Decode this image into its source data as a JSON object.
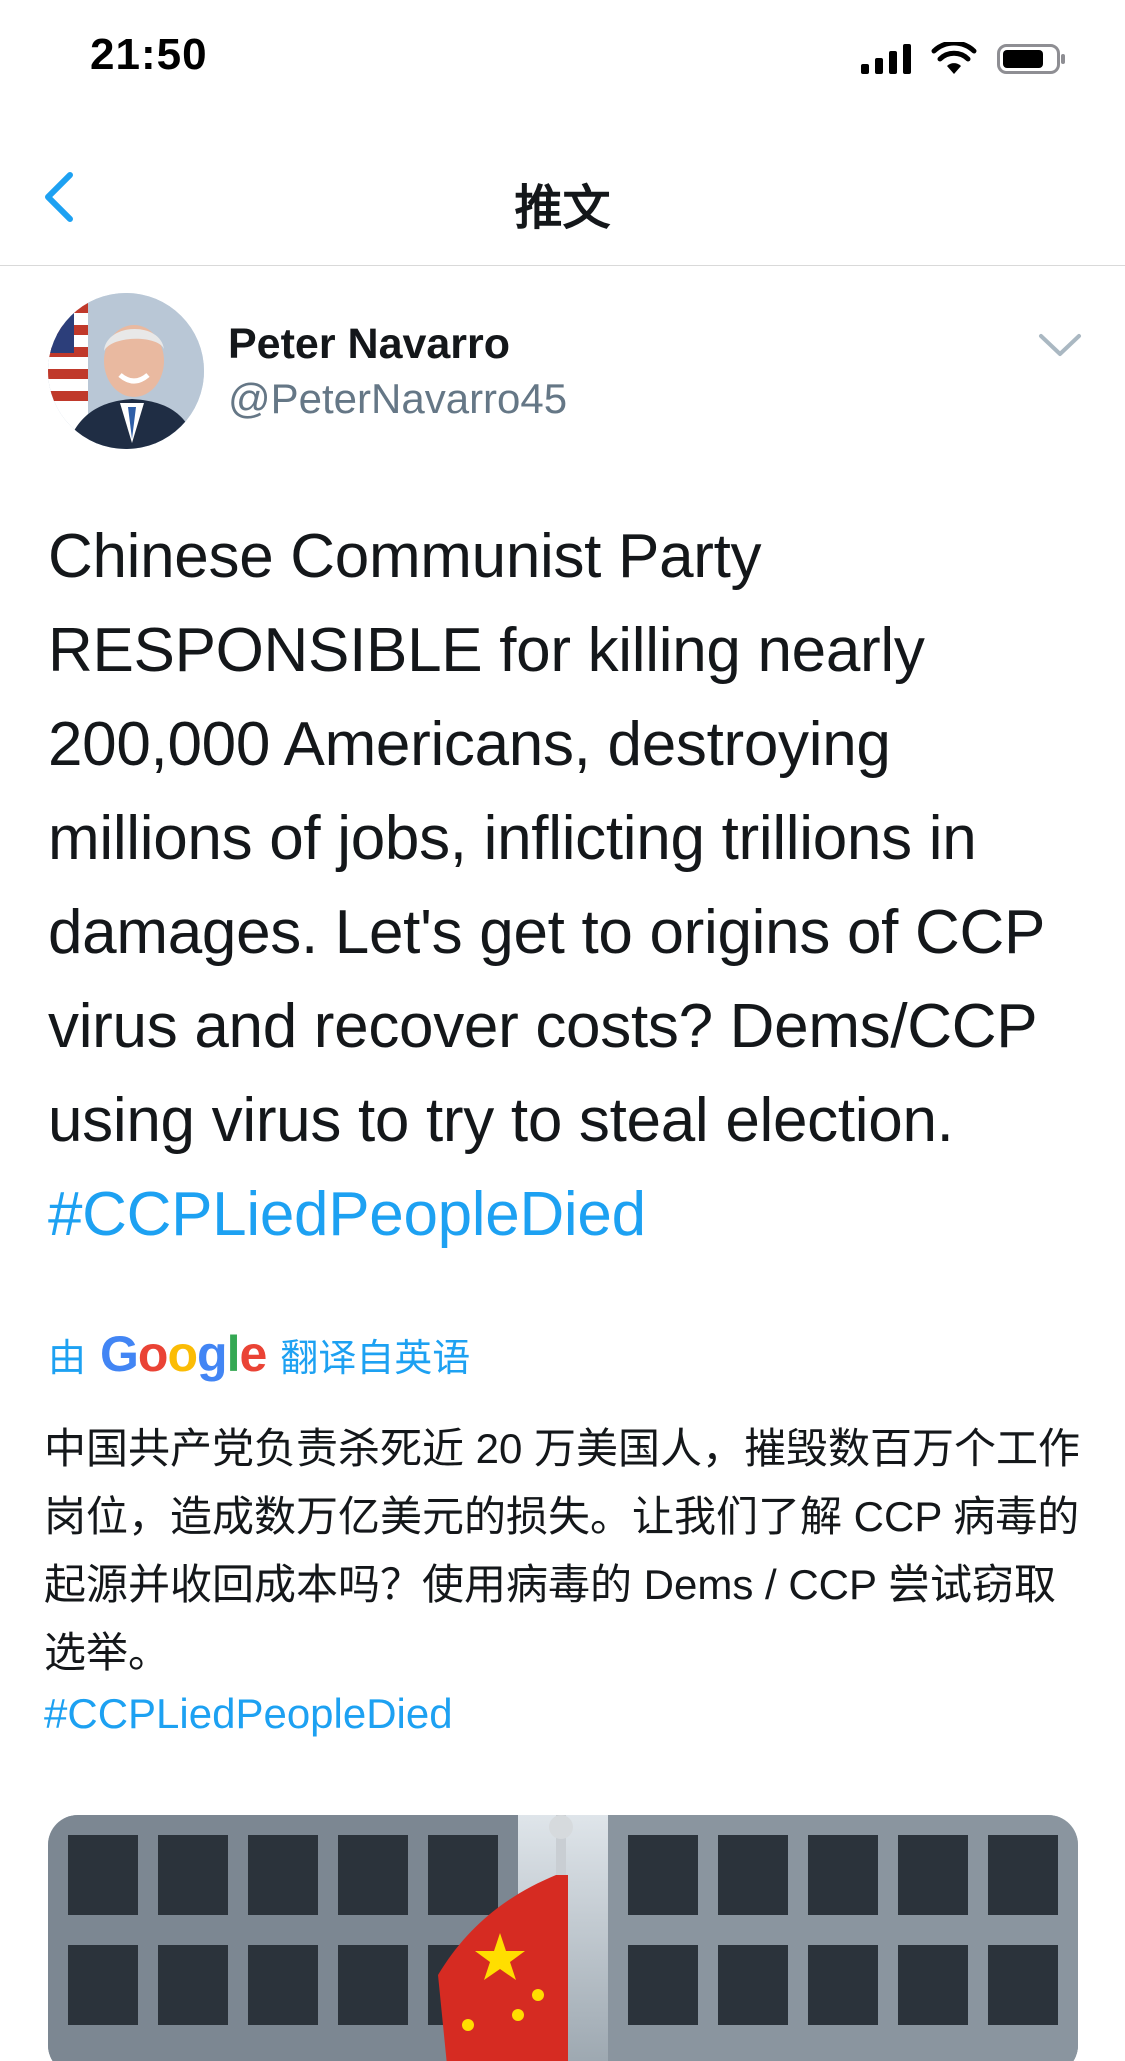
{
  "status_bar": {
    "time": "21:50"
  },
  "nav": {
    "title": "推文"
  },
  "tweet": {
    "author_name": "Peter Navarro",
    "handle": "@PeterNavarro45",
    "text": "Chinese Communist Party RESPONSIBLE for killing nearly 200,000 Americans, destroying millions of jobs, inflicting trillions in damages. Let's get to origins of CCP virus and recover costs? Dems/CCP using virus to try to steal election.",
    "hashtag": "#CCPLiedPeopleDied"
  },
  "translation": {
    "prefix": "由",
    "google_letters": [
      "G",
      "o",
      "o",
      "g",
      "l",
      "e"
    ],
    "suffix": "翻译自英语",
    "text": "中国共产党负责杀死近 20 万美国人，摧毁数百万个工作岗位，造成数万亿美元的损失。让我们了解 CCP 病毒的起源并收回成本吗？使用病毒的 Dems / CCP 尝试窃取选举。",
    "hashtag": "#CCPLiedPeopleDied"
  },
  "icons": {
    "back": "chevron-left-icon",
    "more": "chevron-down-icon"
  },
  "colors": {
    "accent": "#1da1f2",
    "text": "#14171a",
    "secondary": "#657786"
  }
}
